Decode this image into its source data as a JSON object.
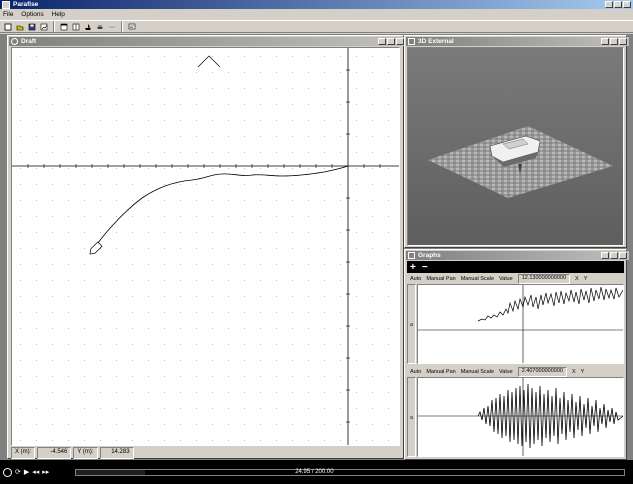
{
  "app": {
    "title": "Parafise"
  },
  "menu": [
    {
      "label": "File"
    },
    {
      "label": "Options"
    },
    {
      "label": "Help"
    }
  ],
  "toolbar_icons": [
    "new-file-icon",
    "open-icon",
    "save-icon",
    "chart-icon",
    "window-icon",
    "window-split-icon",
    "boat-view-icon",
    "boat-3d-icon",
    "disabled-icon",
    "message-icon"
  ],
  "draft": {
    "title": "Draft",
    "status": {
      "x_label": "X (m):",
      "x_value": "-4.546",
      "y_label": "Y (m):",
      "y_value": "14.283"
    }
  },
  "external": {
    "title": "3D External"
  },
  "graphs": {
    "title": "Graphs",
    "add_label": "+",
    "remove_label": "−",
    "panels": [
      {
        "auto": "Auto",
        "pan": "Manual Pan",
        "scale": "Manual Scale",
        "value_label": "Value",
        "value": "12.130000000000",
        "x": "X",
        "y": "Y",
        "side": "a"
      },
      {
        "auto": "Auto",
        "pan": "Manual Pan",
        "scale": "Manual Scale",
        "value_label": "Value",
        "value": "2.407000000000",
        "x": "X",
        "y": "Y",
        "side": "a"
      }
    ]
  },
  "playback": {
    "time": "24.95 / 200.00",
    "progress": 0.125
  },
  "colors": {
    "title_active": "#0a246a",
    "face": "#d4d0c8",
    "plot_bg": "#ffffff",
    "playback_bg": "#000000"
  }
}
